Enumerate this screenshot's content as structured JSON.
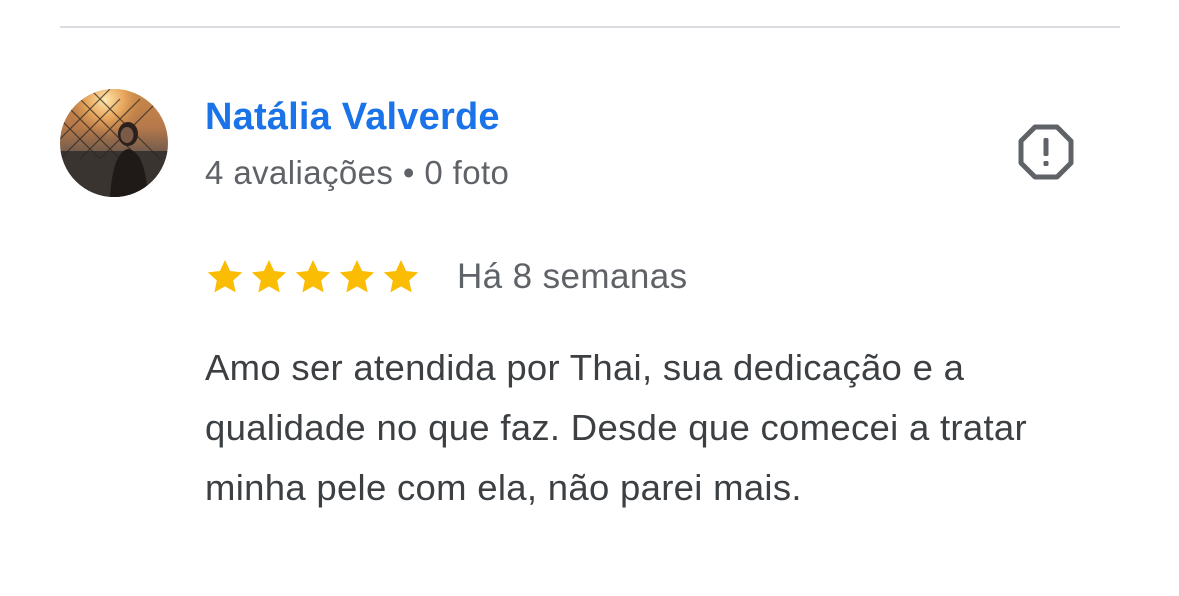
{
  "reviewer": {
    "name": "Natália Valverde",
    "meta": "4 avaliações • 0 foto",
    "avatar": "profile-photo"
  },
  "actions": {
    "report_icon": "report-flag-octagon-icon"
  },
  "review": {
    "rating": 5,
    "rating_max": 5,
    "star_color": "#fbbc04",
    "date": "Há 8 semanas",
    "text": "Amo ser atendida por Thai, sua dedicação e a qualidade no que faz. Desde que comecei a tratar minha pele com ela, não parei mais."
  },
  "colors": {
    "name": "#1a73e8",
    "meta": "#5f6368",
    "text": "#3c4043",
    "divider": "#dadce0"
  }
}
